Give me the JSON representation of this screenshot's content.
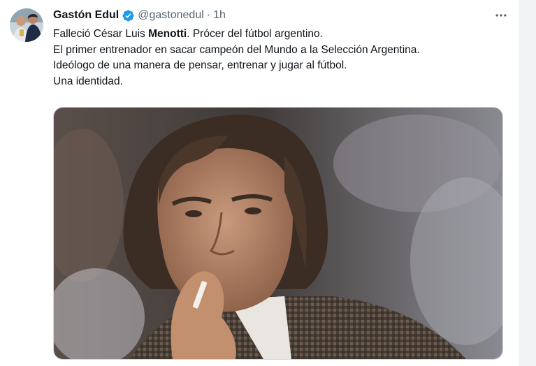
{
  "tweet": {
    "author_name": "Gastón Edul",
    "handle": "@gastonedul",
    "separator": "·",
    "time": "1h",
    "line1_pre": "Falleció César Luis ",
    "line1_bold": "Menotti",
    "line1_post": ". Prócer del fútbol argentino.",
    "line2": "El primer entrenador en sacar campeón del Mundo a la Selección Argentina.",
    "line3": "Ideólogo de una manera de pensar, entrenar y jugar al fútbol.",
    "line4": "Una identidad."
  },
  "icons": {
    "verified": "verified-badge-icon",
    "more": "more-horizontal-icon"
  },
  "colors": {
    "verified_blue": "#1d9bf0",
    "secondary_text": "#536471",
    "primary_text": "#0f1419"
  }
}
